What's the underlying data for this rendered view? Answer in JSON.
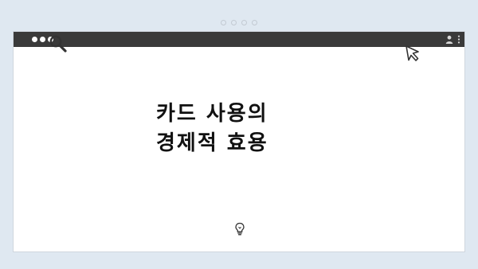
{
  "headline": {
    "line1": "카드 사용의",
    "line2": "경제적 효용"
  },
  "icons": {
    "search": "search-icon",
    "cursor": "cursor-arrow-icon",
    "lightbulb": "lightbulb-icon",
    "user": "user-icon",
    "menu": "kebab-menu-icon"
  },
  "colors": {
    "background": "#dfe8f1",
    "titlebar": "#3a3a3a",
    "window": "#ffffff",
    "text": "#111111"
  }
}
